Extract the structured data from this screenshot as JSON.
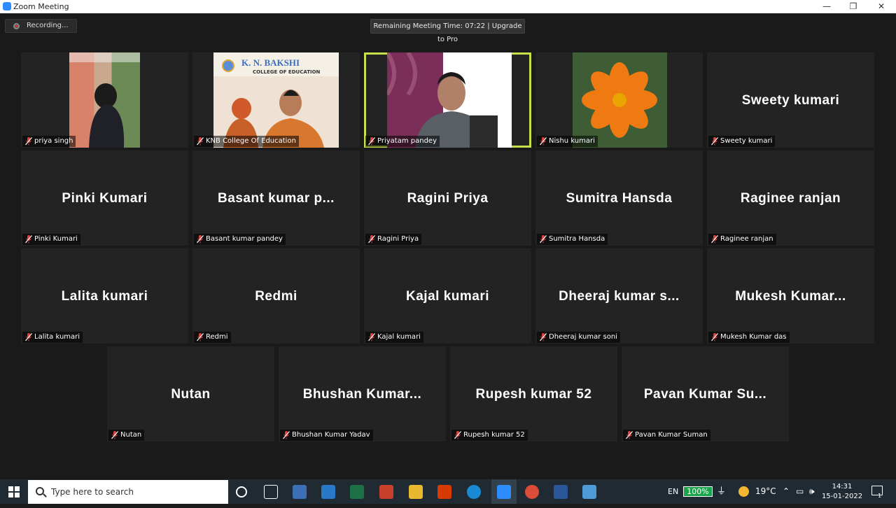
{
  "window": {
    "title": "Zoom Meeting",
    "controls": [
      "—",
      "❐",
      "✕"
    ]
  },
  "recording": {
    "label": "Recording..."
  },
  "timer": {
    "text": "Remaining Meeting Time: 07:22 | Upgrade to Pro"
  },
  "tiles": [
    {
      "name": "priya singh",
      "big": "",
      "video": "girl"
    },
    {
      "name": "KNB College Of Education",
      "big": "",
      "video": "college"
    },
    {
      "name": "Priyatam pandey",
      "big": "",
      "video": "man",
      "active": true
    },
    {
      "name": "Nishu kumari",
      "big": "",
      "video": "flower"
    },
    {
      "name": "Sweety kumari",
      "big": "Sweety kumari"
    },
    {
      "name": "Pinki Kumari",
      "big": "Pinki Kumari"
    },
    {
      "name": "Basant kumar pandey",
      "big": "Basant kumar p..."
    },
    {
      "name": "Ragini  Priya",
      "big": "Ragini  Priya"
    },
    {
      "name": "Sumitra Hansda",
      "big": "Sumitra Hansda"
    },
    {
      "name": "Raginee ranjan",
      "big": "Raginee ranjan"
    },
    {
      "name": "Lalita kumari",
      "big": "Lalita kumari"
    },
    {
      "name": "Redmi",
      "big": "Redmi"
    },
    {
      "name": "Kajal kumari",
      "big": "Kajal kumari"
    },
    {
      "name": "Dheeraj kumar soni",
      "big": "Dheeraj kumar s..."
    },
    {
      "name": "Mukesh Kumar das",
      "big": "Mukesh  Kumar..."
    },
    {
      "name": "Nutan",
      "big": "Nutan"
    },
    {
      "name": "Bhushan Kumar Yadav",
      "big": "Bhushan  Kumar..."
    },
    {
      "name": "Rupesh kumar 52",
      "big": "Rupesh kumar 52"
    },
    {
      "name": "Pavan Kumar Suman",
      "big": "Pavan  Kumar  Su..."
    }
  ],
  "college_banner": {
    "line1": "K. N. BAKSHI",
    "line2": "COLLEGE OF EDUCATION"
  },
  "taskbar": {
    "search_placeholder": "Type here to search",
    "language": "EN",
    "battery": "100%",
    "temperature": "19°C",
    "time": "14:31",
    "date": "15-01-2022",
    "notification_count": "1"
  },
  "colors": {
    "active_border": "#c7e04a",
    "tile_bg": "#232323",
    "stage_bg": "#1a1a1a",
    "mute_red": "#e0403c"
  }
}
